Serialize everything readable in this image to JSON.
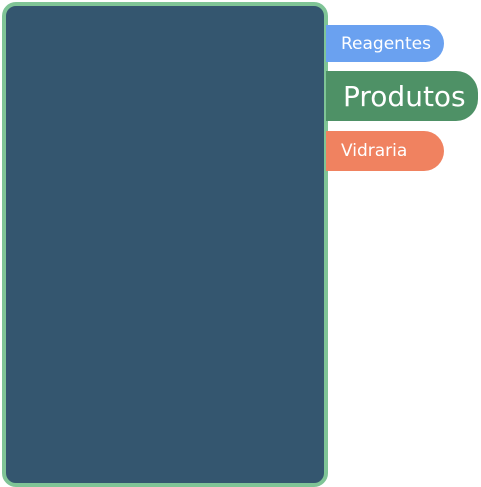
{
  "tabs": [
    {
      "label": "Reagentes",
      "color": "#6aa1f0",
      "active": false
    },
    {
      "label": "Produtos",
      "color": "#4e9166",
      "active": true
    },
    {
      "label": "Vidraria",
      "color": "#f08260",
      "active": false
    }
  ],
  "panel": {
    "background_color": "#34566f",
    "border_color": "#7fc496"
  }
}
